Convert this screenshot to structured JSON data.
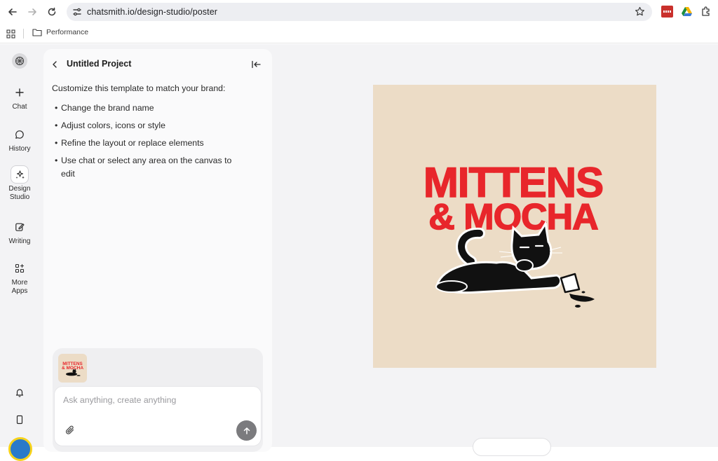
{
  "browser": {
    "url": "chatsmith.io/design-studio/poster",
    "bookmarks": [
      {
        "label": "Performance",
        "icon": "folder-icon"
      }
    ],
    "extension_colors": [
      "#c9302c",
      "#1e8e3e"
    ]
  },
  "rail": {
    "items": [
      {
        "label": "Chat",
        "icon": "plus-icon"
      },
      {
        "label": "History",
        "icon": "chat-bubble-icon"
      },
      {
        "label": "Design\nStudio",
        "icon": "sparkle-icon",
        "active": true
      },
      {
        "label": "Writing",
        "icon": "edit-icon"
      },
      {
        "label": "More\nApps",
        "icon": "apps-grid-icon"
      }
    ]
  },
  "panel": {
    "title": "Untitled Project",
    "intro": "Customize this template to match your brand:",
    "bullets": [
      "Change the brand name",
      "Adjust colors, icons or style",
      "Refine the layout or replace elements",
      "Use chat or select any area on the canvas to edit"
    ],
    "composer": {
      "placeholder": "Ask anything, create anything"
    }
  },
  "poster": {
    "line1": "MITTENS",
    "line2": "& MOCHA",
    "background": "#ecdcc6",
    "text_color": "#e8262b"
  },
  "colors": {
    "accent_send": "#7b7b7e",
    "panel_bg": "#fafafb",
    "app_bg": "#f3f3f5"
  }
}
